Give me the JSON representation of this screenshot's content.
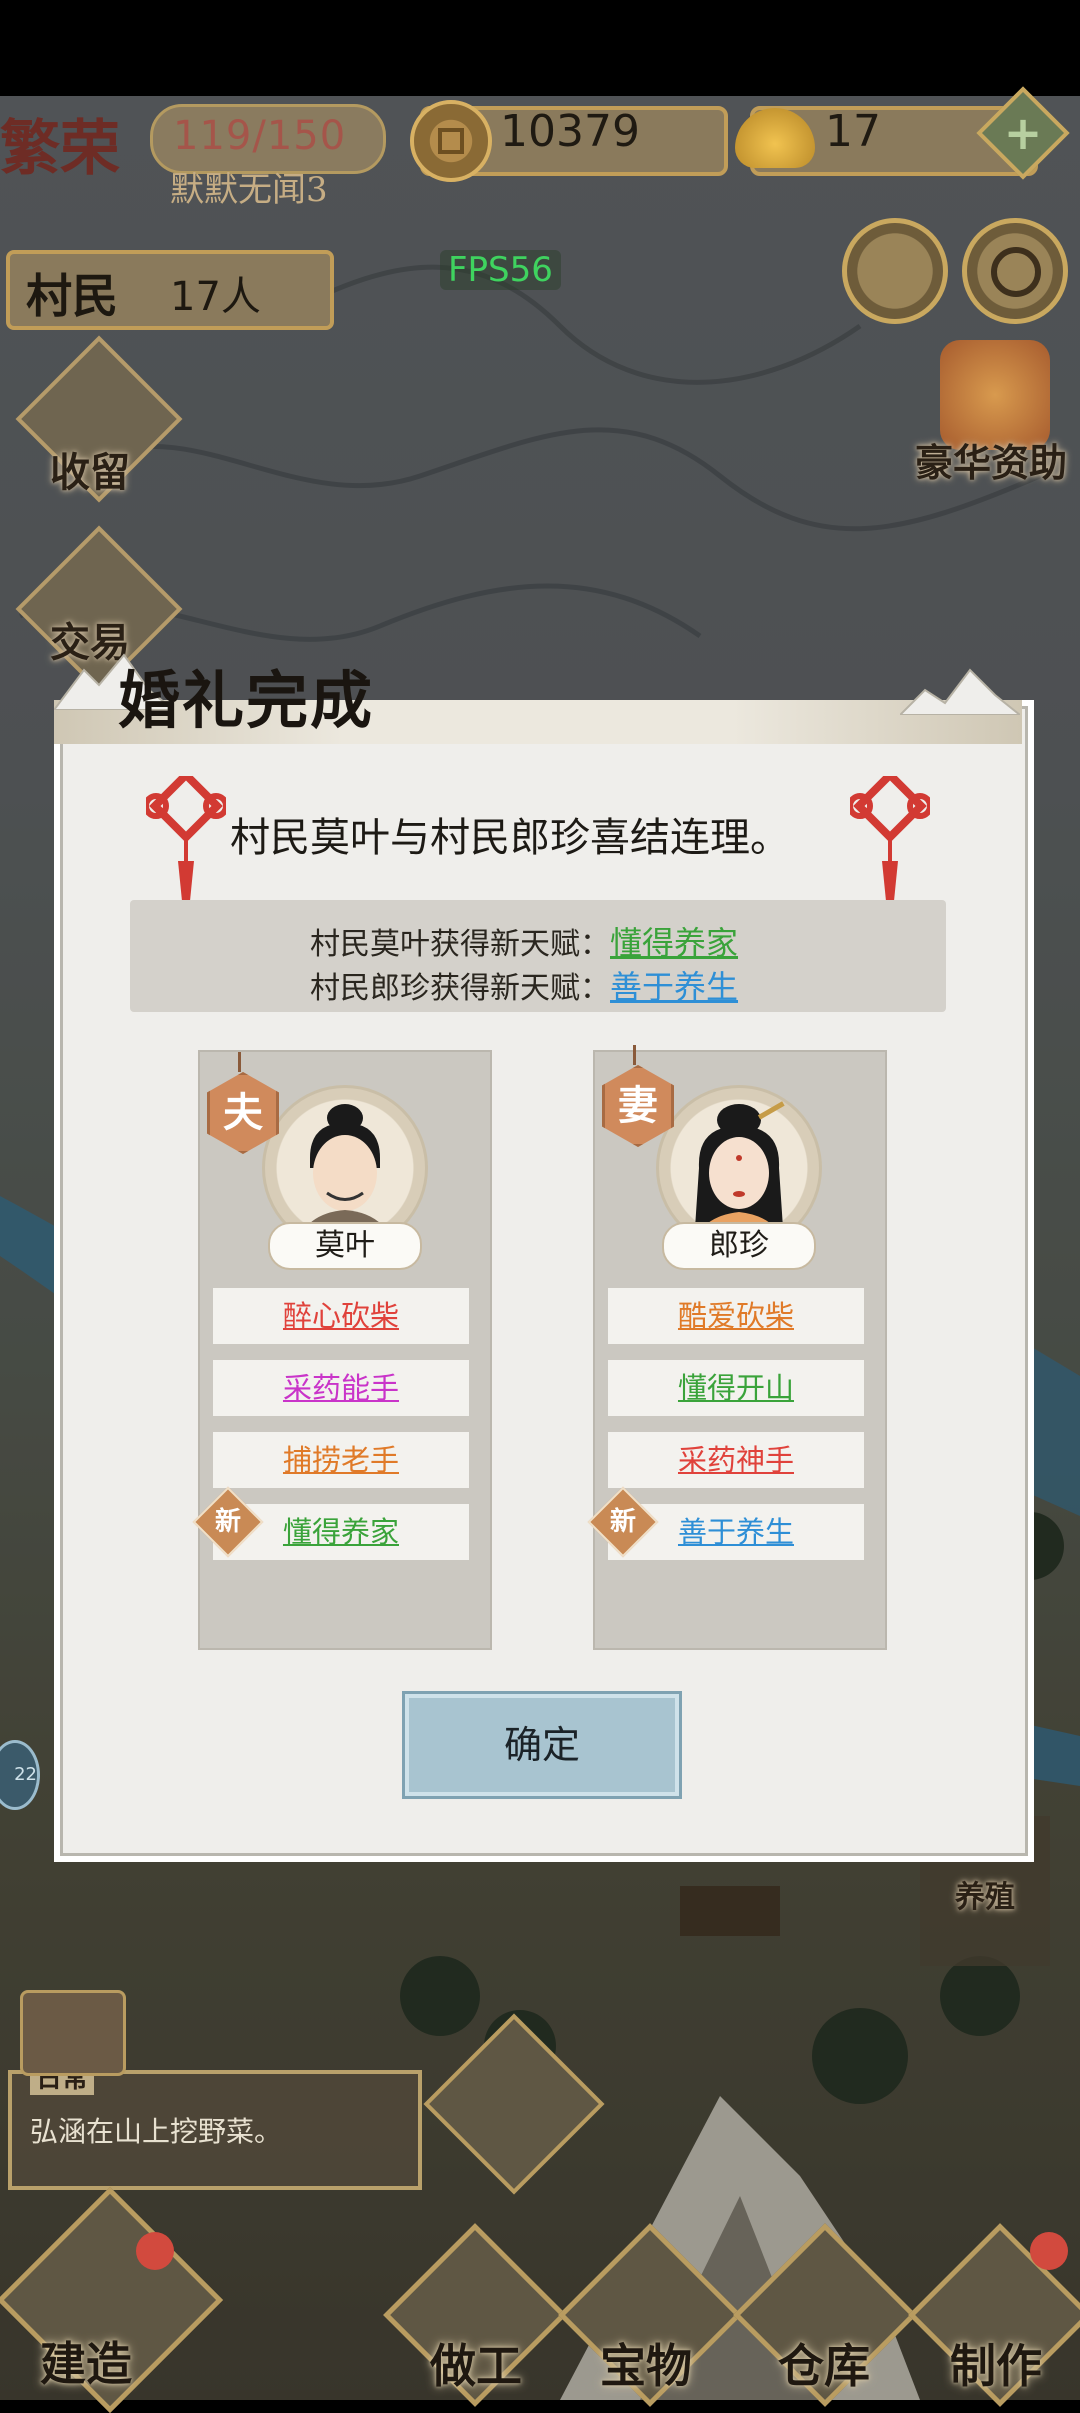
{
  "hud": {
    "prosperity_label": "繁荣",
    "population": "119/150",
    "player_name": "默默无闻3",
    "coins": "10379",
    "gold": "17",
    "villagers_label": "村民",
    "villagers_count": "17人",
    "fps": "FPS56"
  },
  "side_menu": {
    "shelter": "收留",
    "trade": "交易",
    "sponsor": "豪华资助",
    "building": "养殖"
  },
  "dialog": {
    "title": "婚礼完成",
    "headline": "村民莫叶与村民郎珍喜结连理。",
    "talents": [
      {
        "label": "村民莫叶获得新天赋：",
        "talent": "懂得养家",
        "color": "#3aa33a"
      },
      {
        "label": "村民郎珍获得新天赋：",
        "talent": "善于养生",
        "color": "#2e8fd6"
      }
    ],
    "husband": {
      "badge": "夫",
      "name": "莫叶",
      "traits": [
        {
          "text": "醉心砍柴",
          "color": "#e0423b"
        },
        {
          "text": "采药能手",
          "color": "#c934c9"
        },
        {
          "text": "捕捞老手",
          "color": "#e07a28"
        },
        {
          "text": "懂得养家",
          "color": "#3aa33a",
          "new": true
        }
      ]
    },
    "wife": {
      "badge": "妻",
      "name": "郎珍",
      "traits": [
        {
          "text": "酷爱砍柴",
          "color": "#e07a28"
        },
        {
          "text": "懂得开山",
          "color": "#3aa33a"
        },
        {
          "text": "采药神手",
          "color": "#e0423b"
        },
        {
          "text": "善于养生",
          "color": "#2e8fd6",
          "new": true
        }
      ]
    },
    "new_tag": "新",
    "confirm": "确定"
  },
  "log": {
    "tag": "日常",
    "text": "弘涵在山上挖野菜。"
  },
  "bottom_nav": {
    "build": "建造",
    "work": "做工",
    "treasure": "宝物",
    "warehouse": "仓库",
    "craft": "制作"
  },
  "side_left_number": "22"
}
